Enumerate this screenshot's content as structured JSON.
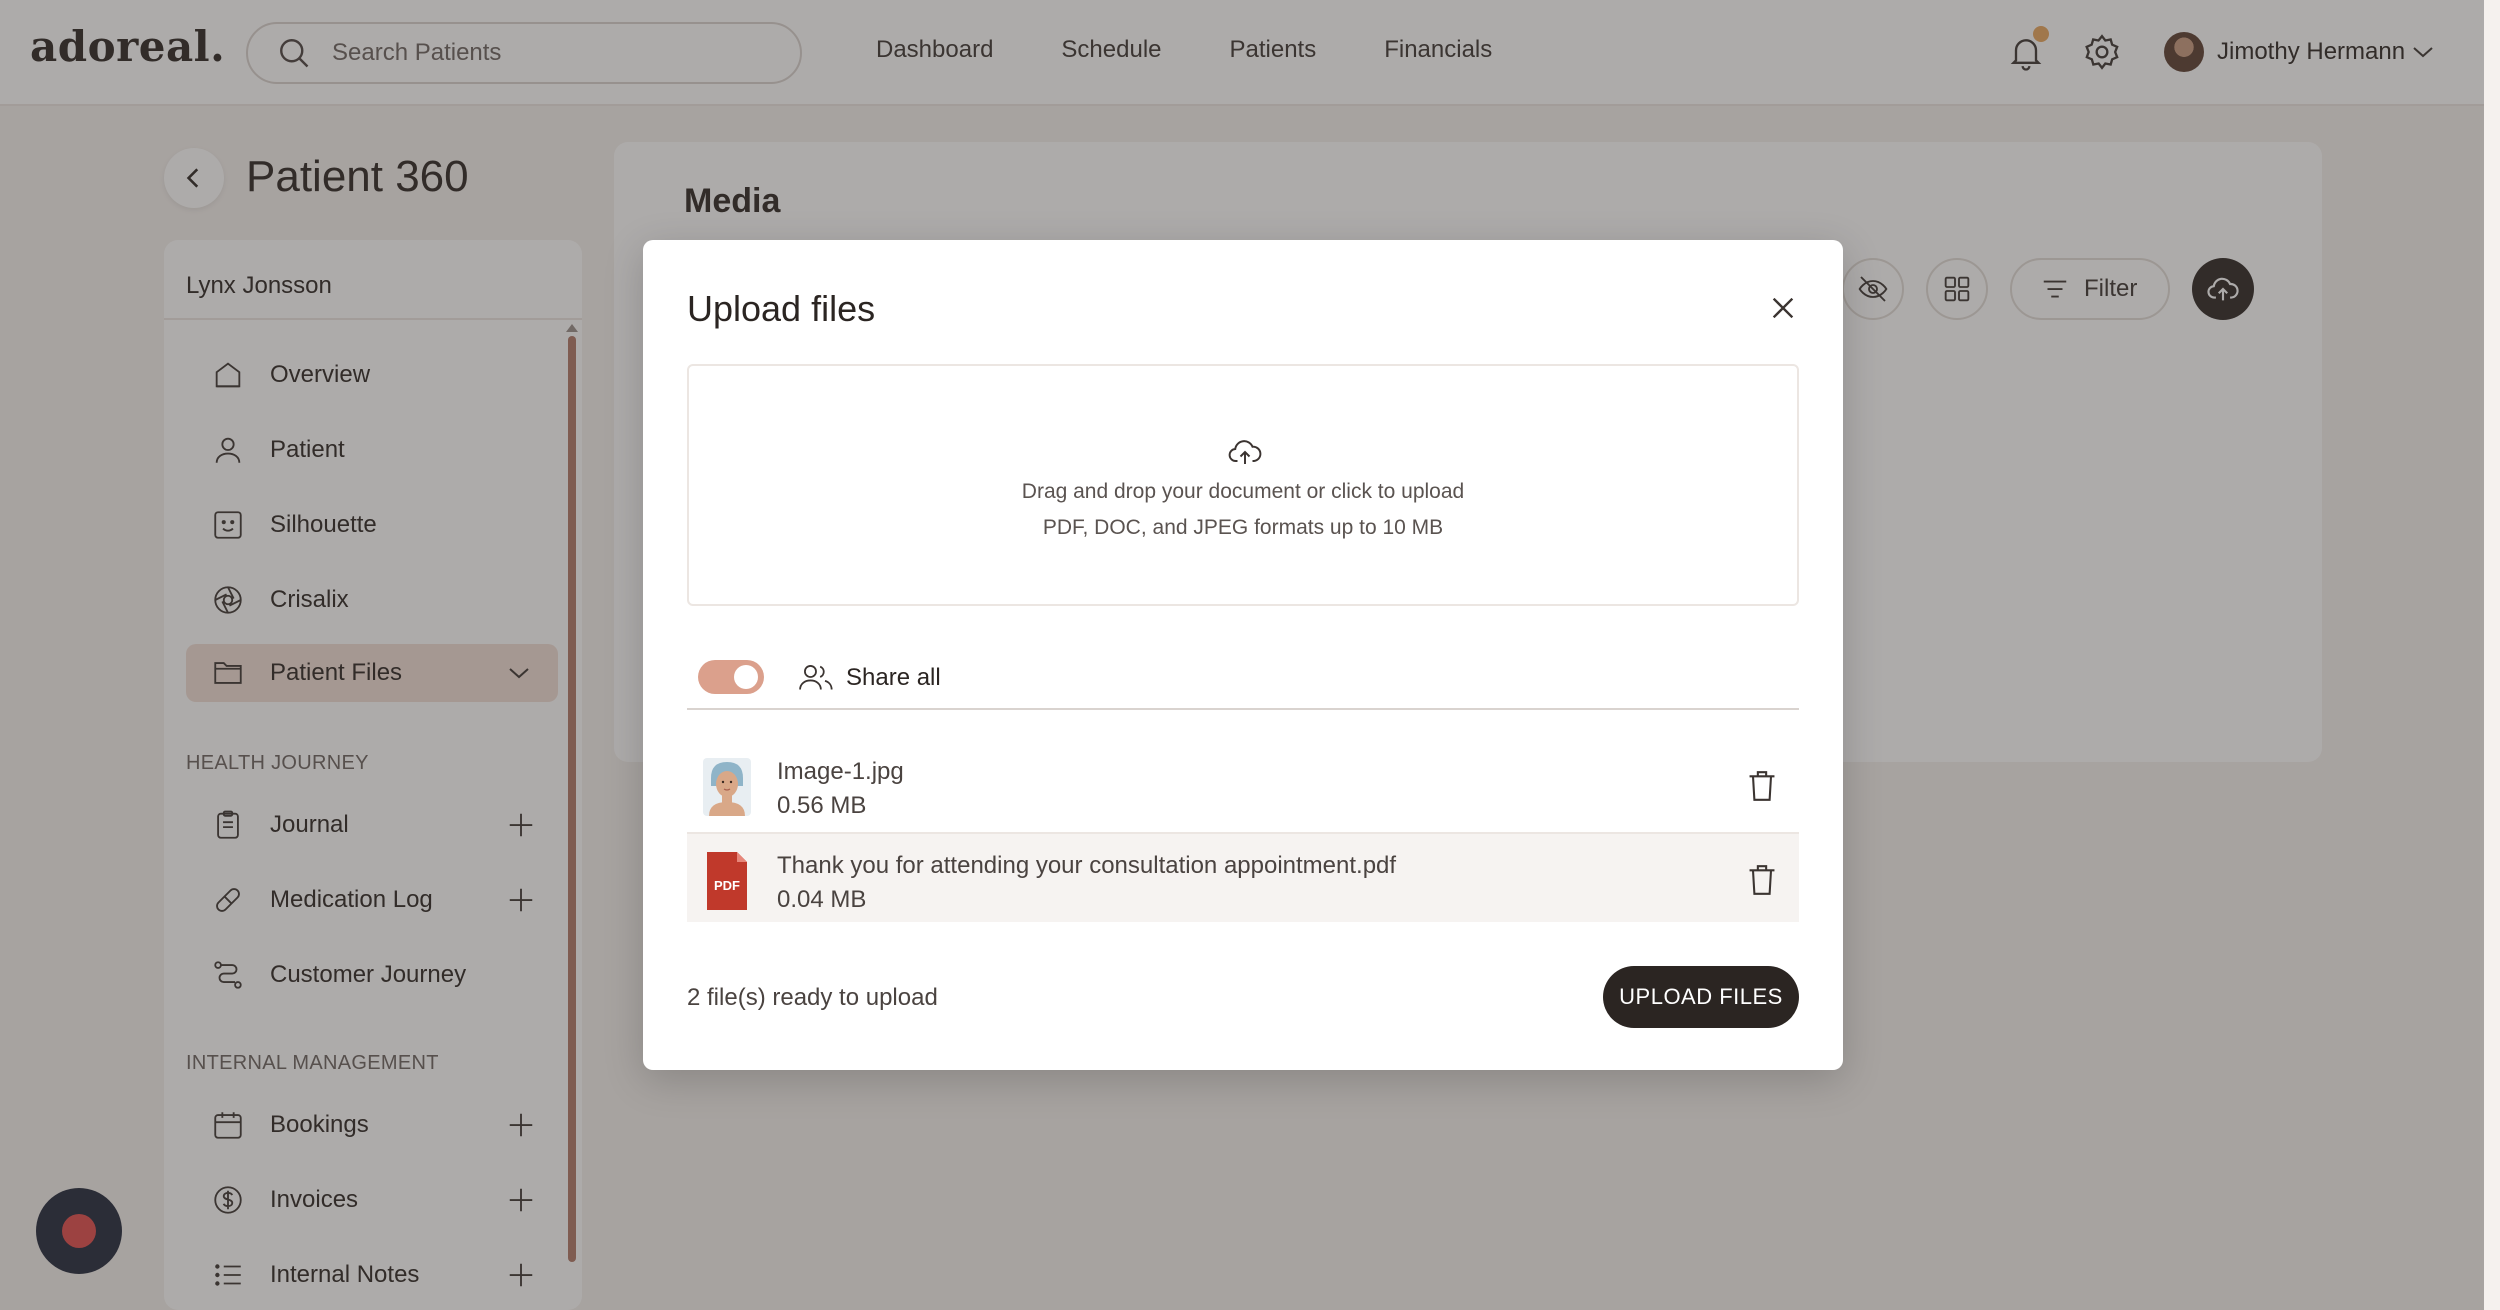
{
  "app": {
    "logo": "adoreal."
  },
  "header": {
    "search_placeholder": "Search Patients",
    "nav": [
      "Dashboard",
      "Schedule",
      "Patients",
      "Financials"
    ],
    "user_name": "Jimothy Hermann",
    "notification_dot_color": "#e8a55c"
  },
  "page": {
    "title": "Patient 360"
  },
  "sidebar": {
    "patient_name": "Lynx Jonsson",
    "items": [
      {
        "label": "Overview",
        "icon": "home-icon"
      },
      {
        "label": "Patient",
        "icon": "user-icon"
      },
      {
        "label": "Silhouette",
        "icon": "face-icon"
      },
      {
        "label": "Crisalix",
        "icon": "aperture-icon"
      },
      {
        "label": "Patient Files",
        "icon": "folder-icon",
        "active": true
      }
    ],
    "sections": [
      {
        "label": "HEALTH JOURNEY",
        "items": [
          {
            "label": "Journal",
            "icon": "clipboard-icon",
            "addable": true
          },
          {
            "label": "Medication Log",
            "icon": "pill-icon",
            "addable": true
          },
          {
            "label": "Customer Journey",
            "icon": "route-icon",
            "addable": false
          }
        ]
      },
      {
        "label": "INTERNAL MANAGEMENT",
        "items": [
          {
            "label": "Bookings",
            "icon": "calendar-icon",
            "addable": true
          },
          {
            "label": "Invoices",
            "icon": "dollar-icon",
            "addable": true
          },
          {
            "label": "Internal Notes",
            "icon": "list-icon",
            "addable": true
          }
        ]
      }
    ],
    "active_color": "#f2dfd6"
  },
  "media": {
    "title": "Media",
    "filter_label": "Filter"
  },
  "modal": {
    "title": "Upload files",
    "dropzone_line1": "Drag and drop your document or click to upload",
    "dropzone_line2": "PDF, DOC, and JPEG formats up to 10 MB",
    "share_all_label": "Share all",
    "share_all_on": true,
    "files": [
      {
        "name": "Image-1.jpg",
        "size": "0.56 MB",
        "type": "image"
      },
      {
        "name": "Thank you for attending your consultation appointment.pdf",
        "size": "0.04 MB",
        "type": "pdf",
        "badge": "PDF"
      }
    ],
    "status": "2 file(s) ready to upload",
    "upload_button": "UPLOAD FILES",
    "toggle_color": "#dba08c",
    "primary_color": "#2b2522"
  }
}
